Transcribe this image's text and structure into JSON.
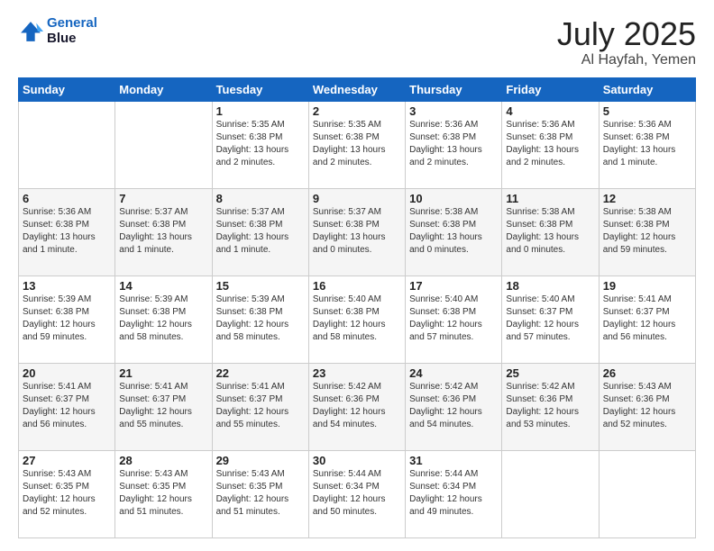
{
  "header": {
    "logo_line1": "General",
    "logo_line2": "Blue",
    "title": "July 2025",
    "subtitle": "Al Hayfah, Yemen"
  },
  "days_of_week": [
    "Sunday",
    "Monday",
    "Tuesday",
    "Wednesday",
    "Thursday",
    "Friday",
    "Saturday"
  ],
  "weeks": [
    [
      {
        "day": "",
        "sunrise": "",
        "sunset": "",
        "daylight": ""
      },
      {
        "day": "",
        "sunrise": "",
        "sunset": "",
        "daylight": ""
      },
      {
        "day": "1",
        "sunrise": "Sunrise: 5:35 AM",
        "sunset": "Sunset: 6:38 PM",
        "daylight": "Daylight: 13 hours and 2 minutes."
      },
      {
        "day": "2",
        "sunrise": "Sunrise: 5:35 AM",
        "sunset": "Sunset: 6:38 PM",
        "daylight": "Daylight: 13 hours and 2 minutes."
      },
      {
        "day": "3",
        "sunrise": "Sunrise: 5:36 AM",
        "sunset": "Sunset: 6:38 PM",
        "daylight": "Daylight: 13 hours and 2 minutes."
      },
      {
        "day": "4",
        "sunrise": "Sunrise: 5:36 AM",
        "sunset": "Sunset: 6:38 PM",
        "daylight": "Daylight: 13 hours and 2 minutes."
      },
      {
        "day": "5",
        "sunrise": "Sunrise: 5:36 AM",
        "sunset": "Sunset: 6:38 PM",
        "daylight": "Daylight: 13 hours and 1 minute."
      }
    ],
    [
      {
        "day": "6",
        "sunrise": "Sunrise: 5:36 AM",
        "sunset": "Sunset: 6:38 PM",
        "daylight": "Daylight: 13 hours and 1 minute."
      },
      {
        "day": "7",
        "sunrise": "Sunrise: 5:37 AM",
        "sunset": "Sunset: 6:38 PM",
        "daylight": "Daylight: 13 hours and 1 minute."
      },
      {
        "day": "8",
        "sunrise": "Sunrise: 5:37 AM",
        "sunset": "Sunset: 6:38 PM",
        "daylight": "Daylight: 13 hours and 1 minute."
      },
      {
        "day": "9",
        "sunrise": "Sunrise: 5:37 AM",
        "sunset": "Sunset: 6:38 PM",
        "daylight": "Daylight: 13 hours and 0 minutes."
      },
      {
        "day": "10",
        "sunrise": "Sunrise: 5:38 AM",
        "sunset": "Sunset: 6:38 PM",
        "daylight": "Daylight: 13 hours and 0 minutes."
      },
      {
        "day": "11",
        "sunrise": "Sunrise: 5:38 AM",
        "sunset": "Sunset: 6:38 PM",
        "daylight": "Daylight: 13 hours and 0 minutes."
      },
      {
        "day": "12",
        "sunrise": "Sunrise: 5:38 AM",
        "sunset": "Sunset: 6:38 PM",
        "daylight": "Daylight: 12 hours and 59 minutes."
      }
    ],
    [
      {
        "day": "13",
        "sunrise": "Sunrise: 5:39 AM",
        "sunset": "Sunset: 6:38 PM",
        "daylight": "Daylight: 12 hours and 59 minutes."
      },
      {
        "day": "14",
        "sunrise": "Sunrise: 5:39 AM",
        "sunset": "Sunset: 6:38 PM",
        "daylight": "Daylight: 12 hours and 58 minutes."
      },
      {
        "day": "15",
        "sunrise": "Sunrise: 5:39 AM",
        "sunset": "Sunset: 6:38 PM",
        "daylight": "Daylight: 12 hours and 58 minutes."
      },
      {
        "day": "16",
        "sunrise": "Sunrise: 5:40 AM",
        "sunset": "Sunset: 6:38 PM",
        "daylight": "Daylight: 12 hours and 58 minutes."
      },
      {
        "day": "17",
        "sunrise": "Sunrise: 5:40 AM",
        "sunset": "Sunset: 6:38 PM",
        "daylight": "Daylight: 12 hours and 57 minutes."
      },
      {
        "day": "18",
        "sunrise": "Sunrise: 5:40 AM",
        "sunset": "Sunset: 6:37 PM",
        "daylight": "Daylight: 12 hours and 57 minutes."
      },
      {
        "day": "19",
        "sunrise": "Sunrise: 5:41 AM",
        "sunset": "Sunset: 6:37 PM",
        "daylight": "Daylight: 12 hours and 56 minutes."
      }
    ],
    [
      {
        "day": "20",
        "sunrise": "Sunrise: 5:41 AM",
        "sunset": "Sunset: 6:37 PM",
        "daylight": "Daylight: 12 hours and 56 minutes."
      },
      {
        "day": "21",
        "sunrise": "Sunrise: 5:41 AM",
        "sunset": "Sunset: 6:37 PM",
        "daylight": "Daylight: 12 hours and 55 minutes."
      },
      {
        "day": "22",
        "sunrise": "Sunrise: 5:41 AM",
        "sunset": "Sunset: 6:37 PM",
        "daylight": "Daylight: 12 hours and 55 minutes."
      },
      {
        "day": "23",
        "sunrise": "Sunrise: 5:42 AM",
        "sunset": "Sunset: 6:36 PM",
        "daylight": "Daylight: 12 hours and 54 minutes."
      },
      {
        "day": "24",
        "sunrise": "Sunrise: 5:42 AM",
        "sunset": "Sunset: 6:36 PM",
        "daylight": "Daylight: 12 hours and 54 minutes."
      },
      {
        "day": "25",
        "sunrise": "Sunrise: 5:42 AM",
        "sunset": "Sunset: 6:36 PM",
        "daylight": "Daylight: 12 hours and 53 minutes."
      },
      {
        "day": "26",
        "sunrise": "Sunrise: 5:43 AM",
        "sunset": "Sunset: 6:36 PM",
        "daylight": "Daylight: 12 hours and 52 minutes."
      }
    ],
    [
      {
        "day": "27",
        "sunrise": "Sunrise: 5:43 AM",
        "sunset": "Sunset: 6:35 PM",
        "daylight": "Daylight: 12 hours and 52 minutes."
      },
      {
        "day": "28",
        "sunrise": "Sunrise: 5:43 AM",
        "sunset": "Sunset: 6:35 PM",
        "daylight": "Daylight: 12 hours and 51 minutes."
      },
      {
        "day": "29",
        "sunrise": "Sunrise: 5:43 AM",
        "sunset": "Sunset: 6:35 PM",
        "daylight": "Daylight: 12 hours and 51 minutes."
      },
      {
        "day": "30",
        "sunrise": "Sunrise: 5:44 AM",
        "sunset": "Sunset: 6:34 PM",
        "daylight": "Daylight: 12 hours and 50 minutes."
      },
      {
        "day": "31",
        "sunrise": "Sunrise: 5:44 AM",
        "sunset": "Sunset: 6:34 PM",
        "daylight": "Daylight: 12 hours and 49 minutes."
      },
      {
        "day": "",
        "sunrise": "",
        "sunset": "",
        "daylight": ""
      },
      {
        "day": "",
        "sunrise": "",
        "sunset": "",
        "daylight": ""
      }
    ]
  ]
}
